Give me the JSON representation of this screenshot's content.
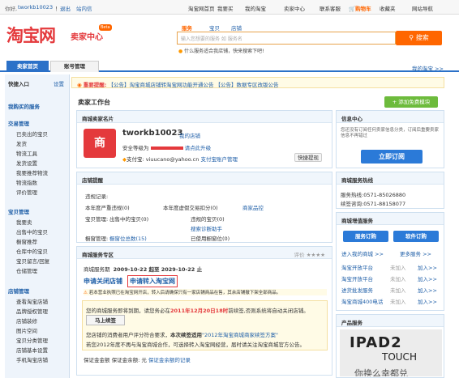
{
  "topbar": {
    "greet": "你好,",
    "user": "tworkb10023",
    "user_suffix": "！",
    "logout": "退出",
    "messages": "站内信",
    "links": [
      "淘宝网首页",
      "我要买",
      "我的淘宝",
      "卖家中心",
      "联系客服",
      "购物车",
      "收藏夹",
      "网站导航"
    ]
  },
  "logo": {
    "main": "淘宝网",
    "sub": "卖家中心",
    "badge": "Beta"
  },
  "search": {
    "tabs": [
      "服务",
      "宝贝",
      "店铺"
    ],
    "placeholder": "输入您想要的服务 如 服务名",
    "button": "搜索",
    "hint": "什么服务适合我店铺，快来搜索下吧!"
  },
  "nav": {
    "tab_seller": "卖家首页",
    "tab_account": "账号管理",
    "my_taobao": "我的淘宝 >>"
  },
  "sidebar": {
    "quick": "快捷入口",
    "settings": "设置",
    "services": "我购买的服务",
    "groups": [
      {
        "title": "交易管理",
        "items": [
          "已卖出的宝贝",
          "发货",
          "物流工具",
          "发货设置",
          "我要推荐物流",
          "物流指数",
          "评价管理"
        ]
      },
      {
        "title": "宝贝管理",
        "items": [
          "我要卖",
          "出售中的宝贝",
          "橱窗推荐",
          "仓库中的宝贝",
          "宝贝留言/回复",
          "仓储管理"
        ]
      },
      {
        "title": "店铺管理",
        "items": [
          "查看淘宝店铺",
          "品牌授权管理",
          "店铺装修",
          "图片空间",
          "宝贝分类管理",
          "店铺基本设置",
          "手机淘宝店铺"
        ]
      }
    ]
  },
  "notice": {
    "label": "重要提醒:",
    "text": "【公告】淘宝商城店铺转淘宝网功能开通公告 【公告】数据专区改版公告"
  },
  "workbench": {
    "title": "卖家工作台",
    "green_btn": "+ 添加免费模块"
  },
  "card": {
    "title": "商城卖家名片",
    "username": "tworkb10023",
    "shop_link": "我的店铺",
    "security": "安全等级为",
    "security_tail": "请点此升级",
    "alipay_label": "支付宝:",
    "alipay_email": "viuucano@yahoo.cn",
    "alipay_manage": "支付宝账户管理",
    "quick_recharge": "快捷提现",
    "icon_text": "商"
  },
  "reminders": {
    "title": "店铺提醒",
    "lines": [
      {
        "a": "违规记录:",
        "b": "",
        "c": ""
      },
      {
        "a": "本年度严重违规(0)",
        "b": "本年度虚假交易扣分(0)",
        "c": "商家品控"
      },
      {
        "a": "宝贝管理:",
        "b": "出售中的宝贝(0)",
        "c": "违规的宝贝(0)"
      },
      {
        "a": "",
        "b": "",
        "c": "搜索诊断助手"
      },
      {
        "a": "橱窗管理:",
        "b": "橱窗位总数(15)",
        "c": "已使用橱窗位(0)"
      }
    ]
  },
  "mall": {
    "title": "商城服务专区",
    "right": "评价 ★★★★",
    "period_label": "商城服务期",
    "period": "2009-10-22 起至 2029-10-22 止",
    "close_link": "申请关闭店铺",
    "convert_link": "申请转入淘宝网",
    "warn": "若本营业执照已在淘宝网开店，转入后请确保只有一家店铺商品在售，其余店铺撤下架全部商品。",
    "exp1": "您的商城服务即将到期，请您务必在",
    "deadline": "2011年12月20日18时",
    "exp2": "前续签,否则系统将自动关闭店铺。",
    "renew": "马上续签",
    "line2a": "您店铺的消费者用户评分符合要求，",
    "line2b": "本次续签适用",
    "line2c": "\"2012年淘宝商城商家续签方案\"",
    "line3": "若您2012年度不再与淘宝商城合作，可选择转入淘宝网经营，届时请关注淘宝商城官方公告。",
    "deposit": "保证金金额  保证金余额: 元",
    "deposit_link": "保证金余额的记录"
  },
  "info": {
    "title": "信息中心",
    "desc": "您还没有订阅任何卖家信息分类，订阅后重要卖家信息不再错过",
    "btn": "立即订阅"
  },
  "hotline": {
    "title": "商城服务热线",
    "phone_label": "服务热线:",
    "phone": "0571-85026880",
    "time": "续签咨询:0571-88158077"
  },
  "mgmt": {
    "title": "商城增值服务",
    "btn1": "服务订购",
    "btn2": "软件订购",
    "rows": [
      {
        "name": "淘宝开放平台",
        "status": "未加入",
        "action": "加入>>"
      },
      {
        "name": "淘宝开放平台",
        "status": "未加入",
        "action": "加入>>"
      },
      {
        "name": "进货批发服务",
        "status": "未加入",
        "action": "加入>>"
      },
      {
        "name": "淘宝商城400电话",
        "status": "未加入",
        "action": "加入>>"
      }
    ],
    "more": "进入我的商城 >>",
    "more2": "更多服务 >>"
  },
  "product": {
    "title": "产品服务",
    "ad1": "IPAD2",
    "ad2": "TOUCH",
    "ad3": "你换么幸都兑"
  },
  "colors": {
    "brand": "#e4393c",
    "accent": "#2b71c8",
    "orange": "#ff6600",
    "panel_bg": "#f0f6fc"
  }
}
